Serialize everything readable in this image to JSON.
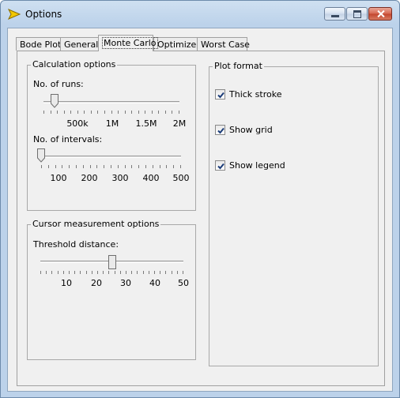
{
  "window": {
    "title": "Options"
  },
  "tabs": [
    {
      "label": "Bode Plot"
    },
    {
      "label": "General"
    },
    {
      "label": "Monte Carlo",
      "active": true
    },
    {
      "label": "Optimizer"
    },
    {
      "label": "Worst Case"
    }
  ],
  "calculation": {
    "group_label": "Calculation options",
    "runs": {
      "label": "No. of runs:",
      "tick_labels": [
        "500k",
        "1M",
        "1.5M",
        "2M"
      ],
      "value_fraction": 0.08
    },
    "intervals": {
      "label": "No. of intervals:",
      "tick_labels": [
        "100",
        "200",
        "300",
        "400",
        "500"
      ],
      "value_fraction": 0.0
    }
  },
  "cursor": {
    "group_label": "Cursor measurement options",
    "threshold": {
      "label": "Threshold distance:",
      "tick_labels": [
        "10",
        "20",
        "30",
        "40",
        "50"
      ],
      "value": 25
    }
  },
  "plot_format": {
    "group_label": "Plot format",
    "checkboxes": [
      {
        "label": "Thick stroke",
        "checked": true
      },
      {
        "label": "Show grid",
        "checked": true
      },
      {
        "label": "Show legend",
        "checked": true
      }
    ]
  }
}
